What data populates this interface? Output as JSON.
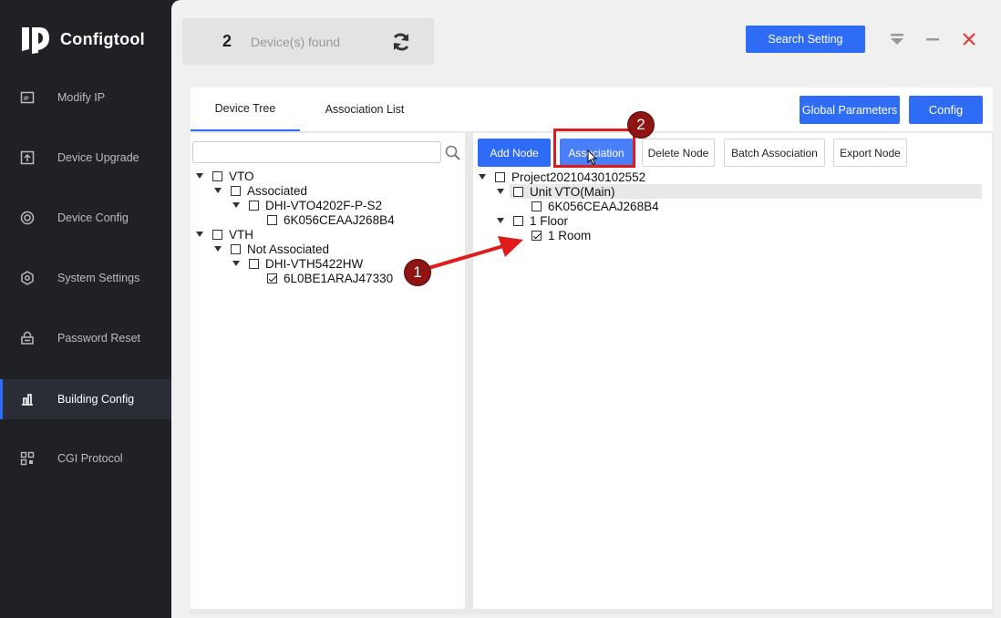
{
  "app": {
    "title": "Configtool"
  },
  "sidebar": {
    "items": [
      {
        "label": "Modify IP",
        "icon": "modify-ip-icon"
      },
      {
        "label": "Device Upgrade",
        "icon": "upload-icon"
      },
      {
        "label": "Device Config",
        "icon": "target-icon"
      },
      {
        "label": "System Settings",
        "icon": "hexagon-gear-icon"
      },
      {
        "label": "Password Reset",
        "icon": "lock-reset-icon"
      },
      {
        "label": "Building Config",
        "icon": "building-icon",
        "active": true
      },
      {
        "label": "CGI Protocol",
        "icon": "qr-grid-icon"
      }
    ]
  },
  "header": {
    "device_count": "2",
    "device_label": "Device(s) found",
    "search_setting_label": "Search Setting"
  },
  "tabs": [
    {
      "label": "Device Tree",
      "active": true
    },
    {
      "label": "Association List",
      "active": false
    }
  ],
  "actions": {
    "global_parameters": "Global Parameters",
    "config": "Config"
  },
  "device_tree": {
    "search_placeholder": "",
    "rows": [
      {
        "label": "VTO",
        "checked": false
      },
      {
        "label": "Associated",
        "checked": false
      },
      {
        "label": "DHI-VTO4202F-P-S2",
        "checked": false
      },
      {
        "label": "6K056CEAAJ268B4",
        "checked": false
      },
      {
        "label": "VTH",
        "checked": false
      },
      {
        "label": "Not Associated",
        "checked": false
      },
      {
        "label": "DHI-VTH5422HW",
        "checked": false
      },
      {
        "label": "6L0BE1ARAJ47330",
        "checked": true
      }
    ]
  },
  "toolbar": {
    "add_node": "Add Node",
    "association": "Association",
    "delete_node": "Delete Node",
    "batch_association": "Batch Association",
    "export_node": "Export Node"
  },
  "project_tree": {
    "rows": [
      {
        "label": "Project20210430102552",
        "checked": false
      },
      {
        "label": "Unit VTO(Main)",
        "checked": false
      },
      {
        "label": "6K056CEAAJ268B4",
        "checked": false
      },
      {
        "label": "1 Floor",
        "checked": false
      },
      {
        "label": "1 Room",
        "checked": true
      }
    ]
  },
  "annotations": {
    "step1": "1",
    "step2": "2"
  },
  "colors": {
    "accent": "#2f6cf6",
    "sidebar": "#1f2125",
    "marker": "#8f1515",
    "highlight": "#e01b1b"
  }
}
